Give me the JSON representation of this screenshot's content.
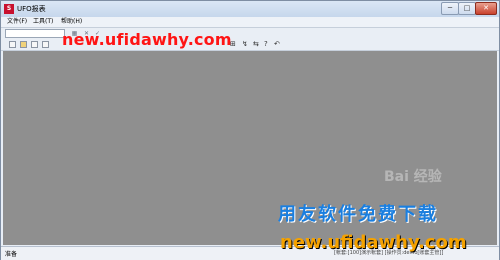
{
  "window": {
    "title": "UFO报表",
    "app_icon": "S",
    "minimize_glyph": "─",
    "maximize_glyph": "□",
    "close_glyph": "✕"
  },
  "menu": {
    "items": [
      {
        "label": "文件(F)"
      },
      {
        "label": "工具(T)"
      },
      {
        "label": "帮助(H)"
      }
    ]
  },
  "toolbar1": {
    "icons": [
      "grid-icon",
      "cancel-icon",
      "confirm-icon"
    ],
    "glyphs": [
      "▦",
      "✕",
      "✓"
    ]
  },
  "toolbar2": {
    "glyphs_right": [
      "⊞",
      "↯",
      "⇆",
      "?",
      "↶"
    ]
  },
  "status": {
    "ready": "准备",
    "info": "[帐套:[100]演示帐套] [操作员:demo[账套主管]]"
  },
  "watermarks": {
    "site_top": "new.ufidawhy.com",
    "slogan": "用友软件免费下载",
    "site_bottom": "new.ufidawhy.com",
    "baidu": "Bai 经验"
  },
  "colors": {
    "workspace": "#8f8f8f",
    "watermark_red": "#ff1414",
    "watermark_blue": "#1a7fe0",
    "watermark_orange": "#f5a200"
  }
}
